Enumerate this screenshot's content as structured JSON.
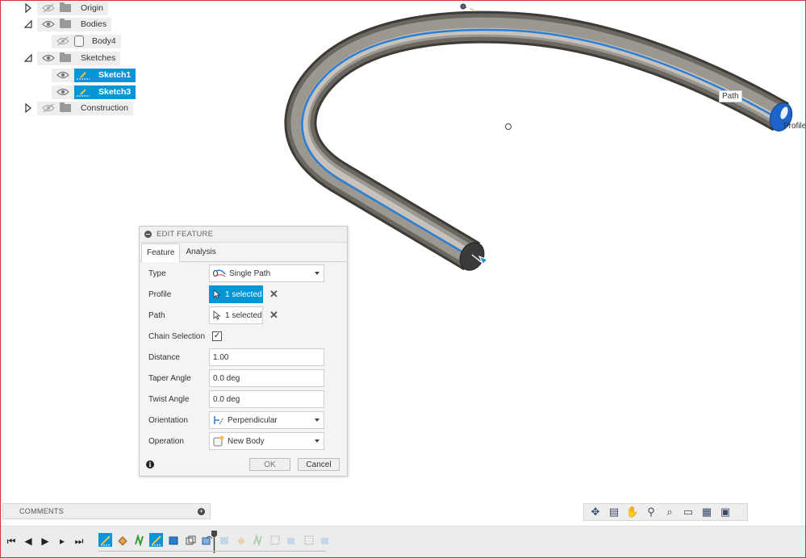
{
  "browser": {
    "items": [
      {
        "label": "Origin",
        "icon": "folder-icon",
        "expander": "collapsed",
        "visible": false,
        "selected": false
      },
      {
        "label": "Bodies",
        "icon": "folder-icon",
        "expander": "expanded",
        "visible": true,
        "selected": false
      },
      {
        "label": "Body4",
        "icon": "body-icon",
        "expander": "none",
        "visible": false,
        "selected": false
      },
      {
        "label": "Sketches",
        "icon": "folder-icon",
        "expander": "expanded",
        "visible": true,
        "selected": false
      },
      {
        "label": "Sketch1",
        "icon": "sketch-icon",
        "expander": "none",
        "visible": true,
        "selected": true
      },
      {
        "label": "Sketch3",
        "icon": "sketch-icon",
        "expander": "none",
        "visible": true,
        "selected": true
      },
      {
        "label": "Construction",
        "icon": "folder-icon",
        "expander": "collapsed",
        "visible": false,
        "selected": false
      }
    ]
  },
  "viewport": {
    "path_tag": "Path",
    "profile_tag": "Profile"
  },
  "edit_feature": {
    "title": "EDIT FEATURE",
    "tabs": [
      "Feature",
      "Analysis"
    ],
    "type": {
      "label": "Type",
      "value": "Single Path"
    },
    "profile": {
      "label": "Profile",
      "value": "1 selected"
    },
    "path": {
      "label": "Path",
      "value": "1 selected"
    },
    "chain_selection": {
      "label": "Chain Selection",
      "checked": true
    },
    "distance": {
      "label": "Distance",
      "value": "1.00"
    },
    "taper_angle": {
      "label": "Taper Angle",
      "value": "0.0 deg"
    },
    "twist_angle": {
      "label": "Twist Angle",
      "value": "0.0 deg"
    },
    "orientation": {
      "label": "Orientation",
      "value": "Perpendicular"
    },
    "operation": {
      "label": "Operation",
      "value": "New Body"
    },
    "ok_label": "OK",
    "cancel_label": "Cancel"
  },
  "comments": {
    "label": "COMMENTS"
  },
  "colors": {
    "accent": "#0696d7",
    "frame": "#c8373b"
  }
}
